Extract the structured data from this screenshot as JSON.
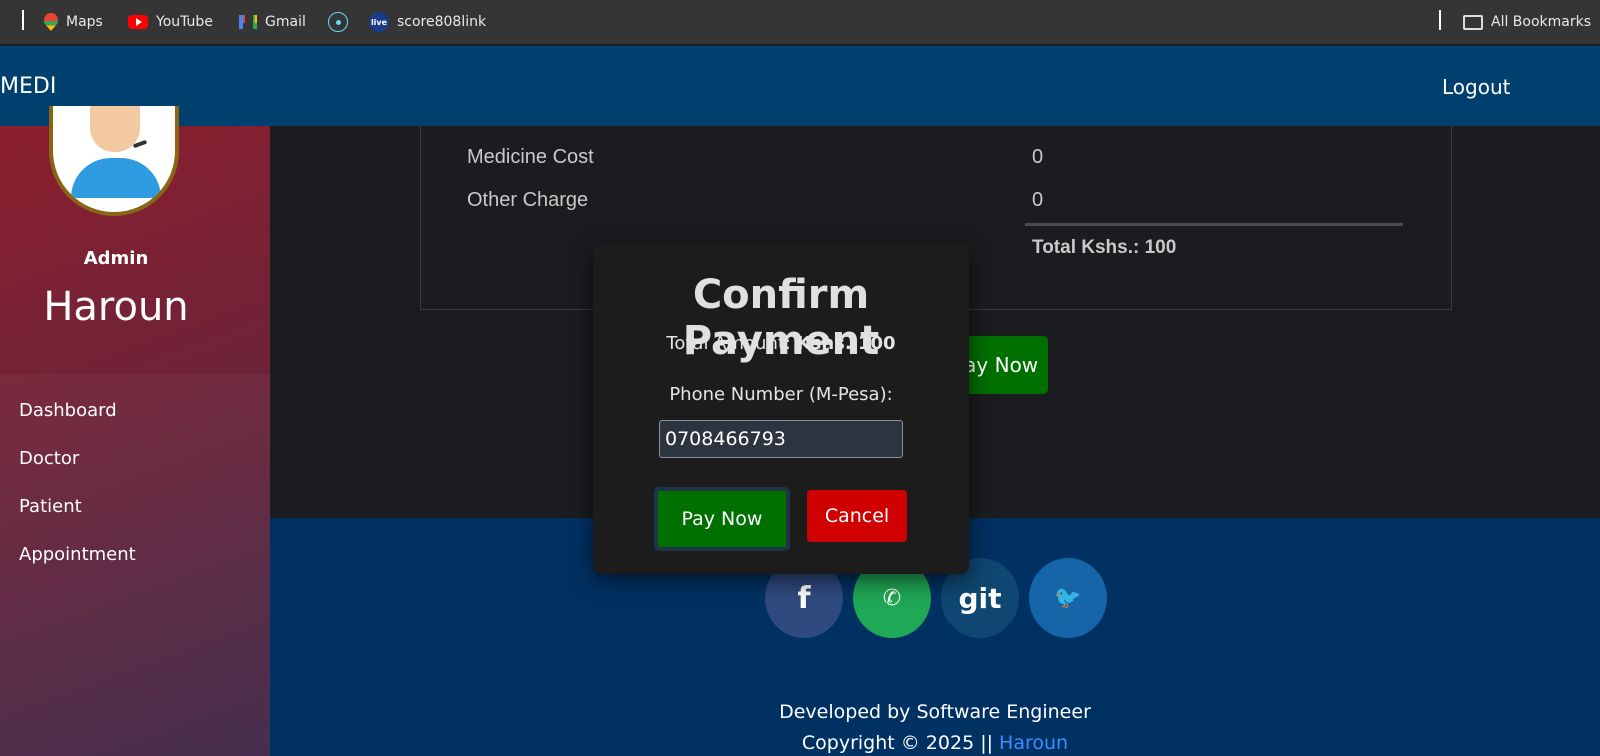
{
  "bookmarks": {
    "items": [
      {
        "label": "Maps",
        "icon": "maps-icon"
      },
      {
        "label": "YouTube",
        "icon": "youtube-icon"
      },
      {
        "label": "Gmail",
        "icon": "gmail-icon"
      },
      {
        "label": "",
        "icon": "react-icon"
      },
      {
        "label": "score808link",
        "icon": "live-icon",
        "icon_text": "live"
      }
    ],
    "all_bookmarks": "All Bookmarks"
  },
  "nav": {
    "brand": "MEDI",
    "logout": "Logout"
  },
  "sidebar": {
    "role": "Admin",
    "username": "Haroun",
    "menu": [
      "Dashboard",
      "Doctor",
      "Patient",
      "Appointment"
    ]
  },
  "bill": {
    "rows": [
      {
        "label": "Medicine Cost",
        "value": "0"
      },
      {
        "label": "Other Charge",
        "value": "0"
      }
    ],
    "total": "Total Kshs.: 100",
    "pay_button": "Pay Now"
  },
  "modal": {
    "title": "Confirm Payment",
    "amount_label": "Total Amount: ",
    "amount_value": "Kshs. 100",
    "phone_label": "Phone Number (M-Pesa):",
    "phone_value": "0708466793",
    "pay_button": "Pay Now",
    "cancel_button": "Cancel"
  },
  "footer": {
    "social": [
      {
        "name": "facebook",
        "glyph": "f"
      },
      {
        "name": "whatsapp",
        "glyph": "✆"
      },
      {
        "name": "git",
        "glyph": "git"
      },
      {
        "name": "twitter",
        "glyph": "🐦"
      }
    ],
    "developed_by": "Developed by Software Engineer",
    "copyright_prefix": "Copyright © 2025 || ",
    "copyright_name": "Haroun"
  },
  "colors": {
    "nav_bg": "#00406f",
    "footer_bg": "#003163",
    "pay_green": "#007000",
    "cancel_red": "#d10000"
  }
}
